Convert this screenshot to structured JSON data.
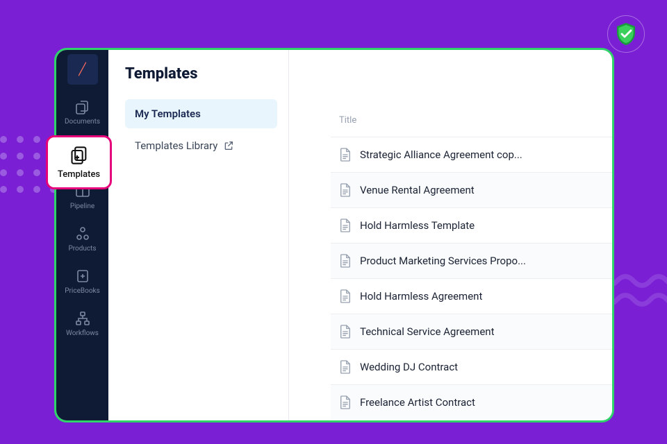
{
  "page_title": "Templates",
  "sidebar": {
    "items": [
      {
        "label": "Documents"
      },
      {
        "label": "Templates"
      },
      {
        "label": "Pipeline"
      },
      {
        "label": "Products"
      },
      {
        "label": "PriceBooks"
      },
      {
        "label": "Workflows"
      }
    ]
  },
  "subnav": {
    "my_templates": "My Templates",
    "library": "Templates Library"
  },
  "table": {
    "column_title": "Title",
    "rows": [
      "Strategic Alliance Agreement cop...",
      "Venue Rental Agreement",
      "Hold Harmless Template",
      "Product Marketing Services Propo...",
      "Hold Harmless Agreement",
      "Technical Service Agreement",
      "Wedding DJ Contract",
      "Freelance Artist Contract"
    ]
  },
  "callout_label": "Templates"
}
